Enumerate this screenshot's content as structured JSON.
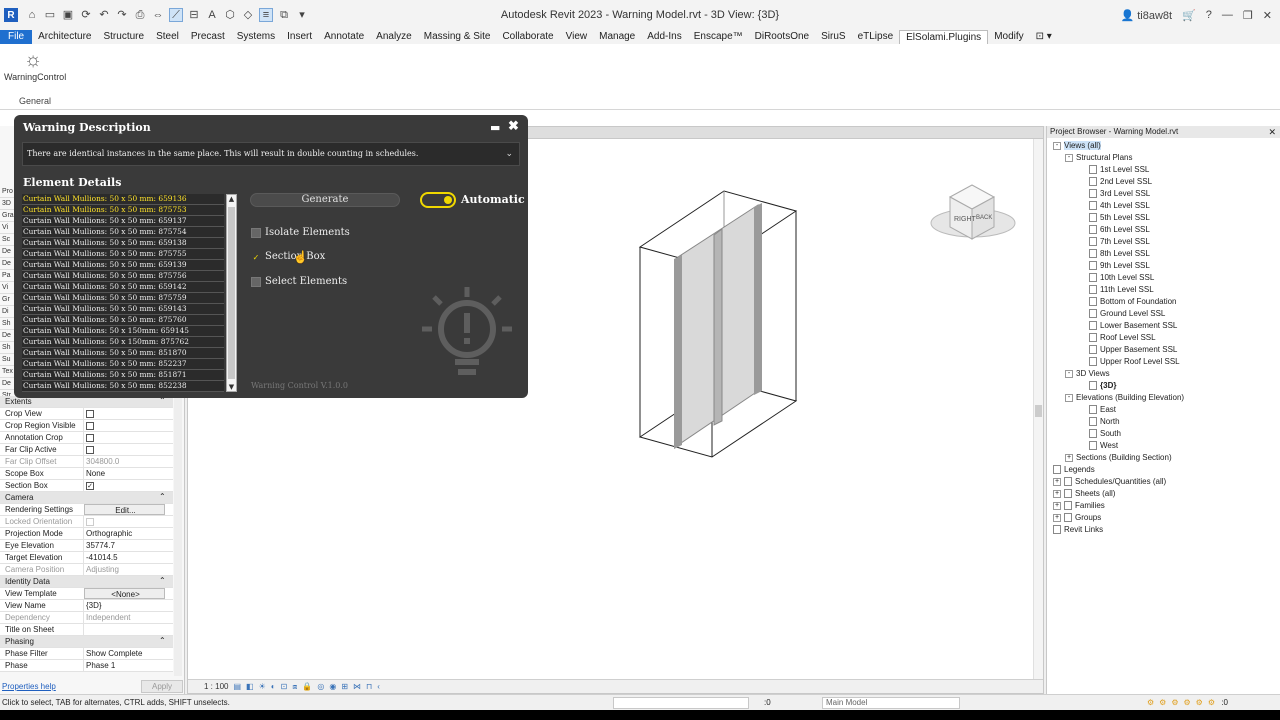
{
  "app": {
    "logo": "R",
    "title": "Autodesk Revit 2023 - Warning Model.rvt - 3D View: {3D}",
    "user": "ti8aw8t"
  },
  "tabs": [
    "File",
    "Architecture",
    "Structure",
    "Steel",
    "Precast",
    "Systems",
    "Insert",
    "Annotate",
    "Analyze",
    "Massing & Site",
    "Collaborate",
    "View",
    "Manage",
    "Add-Ins",
    "Enscape™",
    "DiRootsOne",
    "SiruS",
    "eTLipse",
    "ElSolami.Plugins",
    "Modify"
  ],
  "active_tab": "ElSolami.Plugins",
  "ribbon": {
    "tool_label": "WarningControl",
    "panel_label": "General"
  },
  "properties": {
    "stubs": [
      "Pro",
      "3D",
      "Gra",
      "Vi",
      "Sc",
      "De",
      "De",
      "Pa",
      "Vi",
      "Gr",
      "Di",
      "Sh",
      "De",
      "Sh",
      "Su",
      "Tex",
      "De",
      "Str",
      "Is"
    ],
    "rows": [
      {
        "k": "Extents",
        "v": "",
        "type": "section"
      },
      {
        "k": "Crop View",
        "v": "",
        "cb": "off"
      },
      {
        "k": "Crop Region Visible",
        "v": "",
        "cb": "off"
      },
      {
        "k": "Annotation Crop",
        "v": "",
        "cb": "off"
      },
      {
        "k": "Far Clip Active",
        "v": "",
        "cb": "off"
      },
      {
        "k": "Far Clip Offset",
        "v": "304800.0",
        "grey": true
      },
      {
        "k": "Scope Box",
        "v": "None"
      },
      {
        "k": "Section Box",
        "v": "",
        "cb": "on"
      },
      {
        "k": "Camera",
        "v": "",
        "type": "section"
      },
      {
        "k": "Rendering Settings",
        "v": "Edit...",
        "btn": true
      },
      {
        "k": "Locked Orientation",
        "v": "",
        "grey": true,
        "cb": "grey"
      },
      {
        "k": "Projection Mode",
        "v": "Orthographic"
      },
      {
        "k": "Eye Elevation",
        "v": "35774.7"
      },
      {
        "k": "Target Elevation",
        "v": "-41014.5"
      },
      {
        "k": "Camera Position",
        "v": "Adjusting",
        "grey": true
      },
      {
        "k": "Identity Data",
        "v": "",
        "type": "section"
      },
      {
        "k": "View Template",
        "v": "<None>",
        "btn": true
      },
      {
        "k": "View Name",
        "v": "{3D}"
      },
      {
        "k": "Dependency",
        "v": "Independent",
        "grey": true
      },
      {
        "k": "Title on Sheet",
        "v": ""
      },
      {
        "k": "Phasing",
        "v": "",
        "type": "section"
      },
      {
        "k": "Phase Filter",
        "v": "Show Complete"
      },
      {
        "k": "Phase",
        "v": "Phase 1"
      }
    ],
    "help_link": "Properties help",
    "apply_label": "Apply"
  },
  "viewport": {
    "scale": "1 : 100",
    "viewcube_right": "RIGHT",
    "viewcube_back": "BACK"
  },
  "browser": {
    "title": "Project Browser - Warning Model.rvt",
    "close": "✕",
    "nodes": [
      {
        "t": "Views (all)",
        "lvl": 0,
        "exp": "-",
        "sel": true
      },
      {
        "t": "Structural Plans",
        "lvl": 1,
        "exp": "-"
      },
      {
        "t": "1st Level SSL",
        "lvl": 3,
        "pg": true
      },
      {
        "t": "2nd Level SSL",
        "lvl": 3,
        "pg": true
      },
      {
        "t": "3rd Level SSL",
        "lvl": 3,
        "pg": true
      },
      {
        "t": "4th Level SSL",
        "lvl": 3,
        "pg": true
      },
      {
        "t": "5th Level SSL",
        "lvl": 3,
        "pg": true
      },
      {
        "t": "6th Level SSL",
        "lvl": 3,
        "pg": true
      },
      {
        "t": "7th Level SSL",
        "lvl": 3,
        "pg": true
      },
      {
        "t": "8th Level SSL",
        "lvl": 3,
        "pg": true
      },
      {
        "t": "9th Level SSL",
        "lvl": 3,
        "pg": true
      },
      {
        "t": "10th Level SSL",
        "lvl": 3,
        "pg": true
      },
      {
        "t": "11th Level SSL",
        "lvl": 3,
        "pg": true
      },
      {
        "t": "Bottom of Foundation",
        "lvl": 3,
        "pg": true
      },
      {
        "t": "Ground Level SSL",
        "lvl": 3,
        "pg": true
      },
      {
        "t": "Lower Basement SSL",
        "lvl": 3,
        "pg": true
      },
      {
        "t": "Roof Level SSL",
        "lvl": 3,
        "pg": true
      },
      {
        "t": "Upper Basement SSL",
        "lvl": 3,
        "pg": true
      },
      {
        "t": "Upper Roof Level SSL",
        "lvl": 3,
        "pg": true
      },
      {
        "t": "3D Views",
        "lvl": 1,
        "exp": "-"
      },
      {
        "t": "{3D}",
        "lvl": 3,
        "pg": true,
        "bold": true
      },
      {
        "t": "Elevations (Building Elevation)",
        "lvl": 1,
        "exp": "-"
      },
      {
        "t": "East",
        "lvl": 3,
        "pg": true
      },
      {
        "t": "North",
        "lvl": 3,
        "pg": true
      },
      {
        "t": "South",
        "lvl": 3,
        "pg": true
      },
      {
        "t": "West",
        "lvl": 3,
        "pg": true
      },
      {
        "t": "Sections (Building Section)",
        "lvl": 1,
        "exp": "+"
      },
      {
        "t": "Legends",
        "lvl": 0,
        "icon": true
      },
      {
        "t": "Schedules/Quantities (all)",
        "lvl": 0,
        "exp": "+",
        "icon": true
      },
      {
        "t": "Sheets (all)",
        "lvl": 0,
        "exp": "+",
        "icon": true
      },
      {
        "t": "Families",
        "lvl": 0,
        "exp": "+",
        "icon": true
      },
      {
        "t": "Groups",
        "lvl": 0,
        "exp": "+",
        "icon": true
      },
      {
        "t": "Revit Links",
        "lvl": 0,
        "icon": true
      }
    ]
  },
  "status": {
    "hint": "Click to select, TAB for alternates, CTRL adds, SHIFT unselects.",
    "zero": ":0",
    "model": "Main Model",
    "filter": ":0"
  },
  "dialog": {
    "title": "Warning Description",
    "minimize": "▬",
    "close": "✖",
    "description": "There are identical instances in the same place. This will result in double counting in schedules.",
    "details_heading": "Element Details",
    "items": [
      {
        "t": "Curtain Wall Mullions: 50 x 50 mm: 659136",
        "sel": true
      },
      {
        "t": "Curtain Wall Mullions: 50 x 50 mm: 875753",
        "sel": true
      },
      {
        "t": "Curtain Wall Mullions: 50 x 50 mm: 659137"
      },
      {
        "t": "Curtain Wall Mullions: 50 x 50 mm: 875754"
      },
      {
        "t": "Curtain Wall Mullions: 50 x 50 mm: 659138"
      },
      {
        "t": "Curtain Wall Mullions: 50 x 50 mm: 875755"
      },
      {
        "t": "Curtain Wall Mullions: 50 x 50 mm: 659139"
      },
      {
        "t": "Curtain Wall Mullions: 50 x 50 mm: 875756"
      },
      {
        "t": "Curtain Wall Mullions: 50 x 50 mm: 659142"
      },
      {
        "t": "Curtain Wall Mullions: 50 x 50 mm: 875759"
      },
      {
        "t": "Curtain Wall Mullions: 50 x 50 mm: 659143"
      },
      {
        "t": "Curtain Wall Mullions: 50 x 50 mm: 875760"
      },
      {
        "t": "Curtain Wall Mullions: 50 x 150mm: 659145"
      },
      {
        "t": "Curtain Wall Mullions: 50 x 150mm: 875762"
      },
      {
        "t": "Curtain Wall Mullions: 50 x 50 mm: 851870"
      },
      {
        "t": "Curtain Wall Mullions: 50 x 50 mm: 852237"
      },
      {
        "t": "Curtain Wall Mullions: 50 x 50 mm: 851871"
      },
      {
        "t": "Curtain Wall Mullions: 50 x 50 mm: 852238"
      }
    ],
    "generate_label": "Generate",
    "automatic_label": "Automatic",
    "options": [
      {
        "label": "Isolate Elements",
        "checked": false
      },
      {
        "label": "Section Box",
        "checked": true
      },
      {
        "label": "Select Elements",
        "checked": false
      }
    ],
    "version": "Warning Control V.1.0.0",
    "accent": "#f0d800"
  }
}
